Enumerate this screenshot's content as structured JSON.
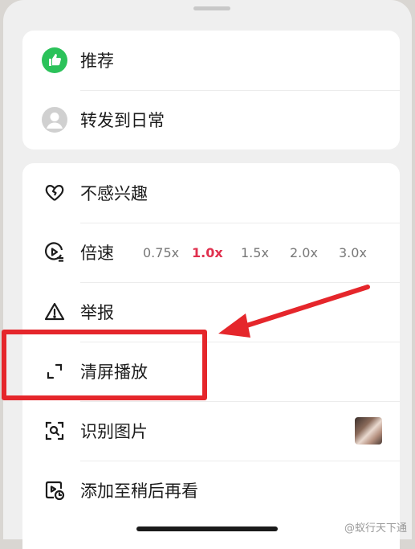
{
  "share_card": {
    "items": [
      {
        "label": "推荐",
        "icon": "thumbs-up-icon"
      },
      {
        "label": "转发到日常",
        "icon": "avatar-icon"
      }
    ]
  },
  "menu": {
    "items": [
      {
        "label": "不感兴趣",
        "icon": "broken-heart-icon"
      },
      {
        "label": "倍速",
        "icon": "playback-speed-icon"
      },
      {
        "label": "举报",
        "icon": "warning-icon"
      },
      {
        "label": "清屏播放",
        "icon": "clear-screen-icon"
      },
      {
        "label": "识别图片",
        "icon": "image-scan-icon"
      },
      {
        "label": "添加至稍后再看",
        "icon": "watch-later-icon"
      }
    ],
    "speed_options": [
      "0.75x",
      "1.0x",
      "1.5x",
      "2.0x",
      "3.0x"
    ],
    "selected_speed": "1.0x"
  },
  "watermark": "@蚁行天下通",
  "colors": {
    "accent": "#e0304e",
    "annotation": "#e5262b",
    "recommend_green": "#2bc25a"
  }
}
